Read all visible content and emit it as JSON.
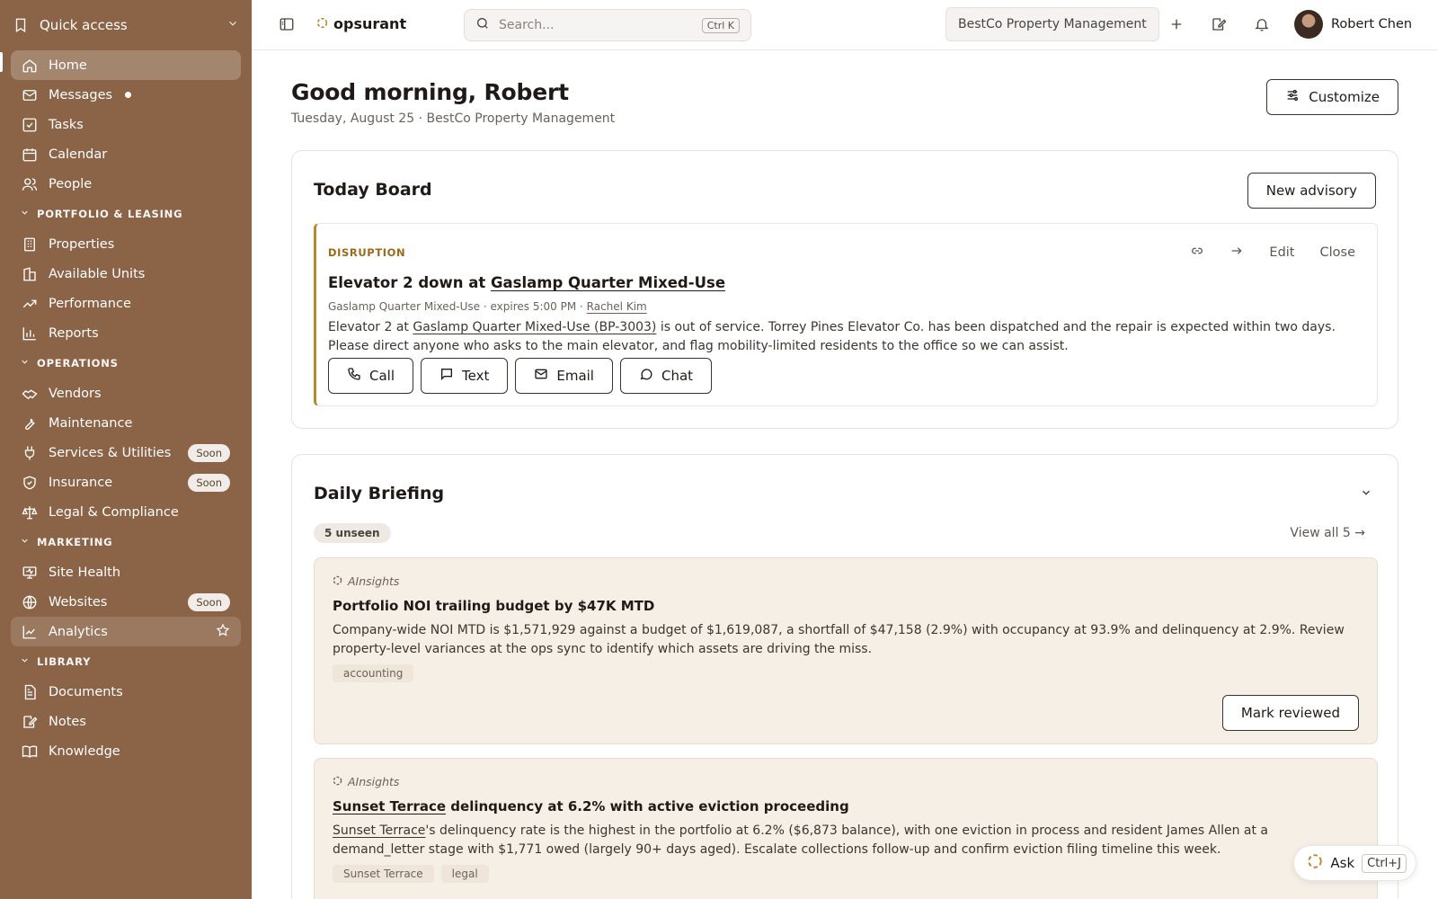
{
  "sidebar": {
    "quick_access": "Quick access",
    "main_items": [
      {
        "label": "Home"
      },
      {
        "label": "Messages"
      },
      {
        "label": "Tasks"
      },
      {
        "label": "Calendar"
      },
      {
        "label": "People"
      }
    ],
    "sections": [
      {
        "title": "PORTFOLIO & LEASING",
        "items": [
          "Properties",
          "Available Units",
          "Performance",
          "Reports"
        ]
      },
      {
        "title": "OPERATIONS",
        "items": [
          "Vendors",
          "Maintenance",
          "Services & Utilities",
          "Insurance",
          "Legal & Compliance"
        ]
      },
      {
        "title": "MARKETING",
        "items": [
          "Site Health",
          "Websites",
          "Analytics"
        ]
      },
      {
        "title": "LIBRARY",
        "items": [
          "Documents",
          "Notes",
          "Knowledge"
        ]
      }
    ],
    "soon_label": "Soon"
  },
  "topbar": {
    "logo": "opsurant",
    "search_placeholder": "Search...",
    "search_shortcut": "Ctrl K",
    "org": "BestCo Property Management",
    "user_name": "Robert Chen"
  },
  "main": {
    "greeting": "Good morning, Robert",
    "subtitle": "Tuesday, August 25 · BestCo Property Management",
    "customize": "Customize",
    "today_board": {
      "title": "Today Board",
      "new_advisory": "New advisory",
      "advisory": {
        "tag": "DISRUPTION",
        "edit": "Edit",
        "close": "Close",
        "title_prefix": "Elevator 2 down at ",
        "title_link": "Gaslamp Quarter Mixed-Use",
        "meta_property": "Gaslamp Quarter Mixed-Use",
        "meta_expires": " · expires 5:00 PM · ",
        "meta_person": "Rachel Kim",
        "body_prefix": "Elevator 2 at ",
        "body_link": "Gaslamp Quarter Mixed-Use (BP-3003)",
        "body_rest": " is out of service. Torrey Pines Elevator Co. has been dispatched and the repair is expected within two days. Please direct anyone who asks to the main elevator, and flag mobility-limited residents to the office so we can assist.",
        "buttons": [
          "Call",
          "Text",
          "Email",
          "Chat"
        ]
      }
    },
    "daily_briefing": {
      "title": "Daily Briefing",
      "unseen": "5 unseen",
      "view_all": "View all 5 →",
      "insights": [
        {
          "source": "AInsights",
          "title": "Portfolio NOI trailing budget by $47K MTD",
          "body": "Company-wide NOI MTD is $1,571,929 against a budget of $1,619,087, a shortfall of $47,158 (2.9%) with occupancy at 93.9% and delinquency at 2.9%. Review property-level variances at the ops sync to identify which assets are driving the miss.",
          "chips": [
            "accounting"
          ],
          "action": "Mark reviewed"
        },
        {
          "source": "AInsights",
          "title_link": "Sunset Terrace",
          "title_rest": " delinquency at 6.2% with active eviction proceeding",
          "body_link": "Sunset Terrace",
          "body_rest": "'s delinquency rate is the highest in the portfolio at 6.2% ($6,873 balance), with one eviction in process and resident James Allen at a demand_letter stage with $1,771 owed (largely 90+ days aged). Escalate collections follow-up and confirm eviction filing timeline this week.",
          "chips": [
            "Sunset Terrace",
            "legal"
          ]
        }
      ]
    },
    "ask": {
      "label": "Ask",
      "shortcut": "Ctrl+J"
    }
  }
}
